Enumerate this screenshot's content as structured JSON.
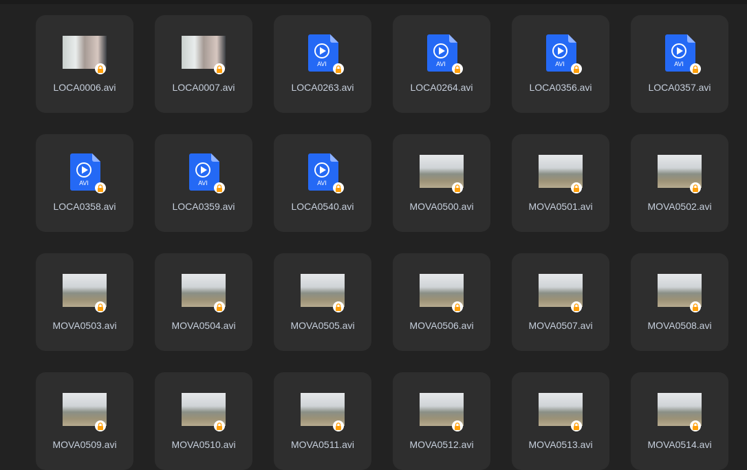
{
  "colors": {
    "lock": "#ff9f0a",
    "avi_icon": "#2469f5"
  },
  "files": [
    {
      "name": "LOCA0006.avi",
      "thumb": "town",
      "locked": true
    },
    {
      "name": "LOCA0007.avi",
      "thumb": "town",
      "locked": true
    },
    {
      "name": "LOCA0263.avi",
      "thumb": "avi-icon",
      "icon_text": "AVI",
      "locked": true
    },
    {
      "name": "LOCA0264.avi",
      "thumb": "avi-icon",
      "icon_text": "AVI",
      "locked": true
    },
    {
      "name": "LOCA0356.avi",
      "thumb": "avi-icon",
      "icon_text": "AVI",
      "locked": true
    },
    {
      "name": "LOCA0357.avi",
      "thumb": "avi-icon",
      "icon_text": "AVI",
      "locked": true
    },
    {
      "name": "LOCA0358.avi",
      "thumb": "avi-icon",
      "icon_text": "AVI",
      "locked": true
    },
    {
      "name": "LOCA0359.avi",
      "thumb": "avi-icon",
      "icon_text": "AVI",
      "locked": true
    },
    {
      "name": "LOCA0540.avi",
      "thumb": "avi-icon",
      "icon_text": "AVI",
      "locked": true
    },
    {
      "name": "MOVA0500.avi",
      "thumb": "road",
      "locked": true
    },
    {
      "name": "MOVA0501.avi",
      "thumb": "road",
      "locked": true
    },
    {
      "name": "MOVA0502.avi",
      "thumb": "road",
      "locked": true
    },
    {
      "name": "MOVA0503.avi",
      "thumb": "road",
      "locked": true
    },
    {
      "name": "MOVA0504.avi",
      "thumb": "road",
      "locked": true
    },
    {
      "name": "MOVA0505.avi",
      "thumb": "road",
      "locked": true
    },
    {
      "name": "MOVA0506.avi",
      "thumb": "road",
      "locked": true
    },
    {
      "name": "MOVA0507.avi",
      "thumb": "road",
      "locked": true
    },
    {
      "name": "MOVA0508.avi",
      "thumb": "road",
      "locked": true
    },
    {
      "name": "MOVA0509.avi",
      "thumb": "road",
      "locked": true
    },
    {
      "name": "MOVA0510.avi",
      "thumb": "road",
      "locked": true
    },
    {
      "name": "MOVA0511.avi",
      "thumb": "road",
      "locked": true
    },
    {
      "name": "MOVA0512.avi",
      "thumb": "road",
      "locked": true
    },
    {
      "name": "MOVA0513.avi",
      "thumb": "road",
      "locked": true
    },
    {
      "name": "MOVA0514.avi",
      "thumb": "road",
      "locked": true
    }
  ]
}
